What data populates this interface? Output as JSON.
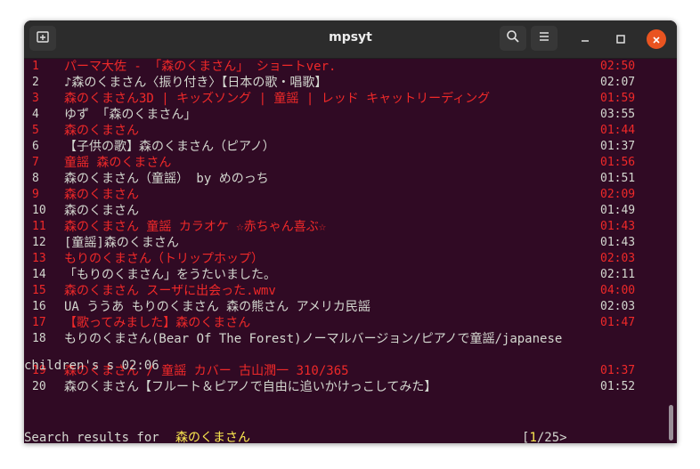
{
  "window": {
    "title": "mpsyt"
  },
  "icons": {
    "new_tab": "new-tab-icon",
    "search": "search-icon",
    "menu": "hamburger-menu-icon",
    "minimize": "minimize-icon",
    "maximize": "maximize-icon",
    "close": "close-icon"
  },
  "colors": {
    "terminal_bg": "#300a24",
    "odd_row": "#ef2929",
    "even_row": "#d3d7cf",
    "highlight": "#fce94f",
    "close_button": "#e95420"
  },
  "results": [
    {
      "num": "1",
      "title": "パーマ大佐 - 「森のくまさん」 ショートver.",
      "duration": "02:50"
    },
    {
      "num": "2",
      "title": "♪森のくまさん〈振り付き〉【日本の歌・唱歌】",
      "duration": "02:07"
    },
    {
      "num": "3",
      "title": "森のくまさん3D | キッズソング | 童謡  | レッド キャットリーディング",
      "duration": "01:59"
    },
    {
      "num": "4",
      "title": "ゆず  「森のくまさん」",
      "duration": "03:55"
    },
    {
      "num": "5",
      "title": "森のくまさん",
      "duration": "01:44"
    },
    {
      "num": "6",
      "title": "【子供の歌】森のくまさん（ピアノ）",
      "duration": "01:37"
    },
    {
      "num": "7",
      "title": "童謡 森のくまさん",
      "duration": "01:56"
    },
    {
      "num": "8",
      "title": "森のくまさん（童謡）  by めのっち",
      "duration": "01:51"
    },
    {
      "num": "9",
      "title": "森のくまさん",
      "duration": "02:09"
    },
    {
      "num": "10",
      "title": "森のくまさん",
      "duration": "01:49"
    },
    {
      "num": "11",
      "title": "森のくまさん  童謡  カラオケ  ☆赤ちゃん喜ぶ☆",
      "duration": "01:43"
    },
    {
      "num": "12",
      "title": "[童謡]森のくまさん",
      "duration": "01:43"
    },
    {
      "num": "13",
      "title": "もりのくまさん（トリップホップ）",
      "duration": "02:03"
    },
    {
      "num": "14",
      "title": "「もりのくまさん」をうたいました。",
      "duration": "02:11"
    },
    {
      "num": "15",
      "title": "森のくまさん スーザに出会った.wmv",
      "duration": "04:00"
    },
    {
      "num": "16",
      "title": "UA ううあ もりのくまさん 森の熊さん アメリカ民謡",
      "duration": "02:03"
    },
    {
      "num": "17",
      "title": "【歌ってみました】森のくまさん",
      "duration": "01:47"
    },
    {
      "num": "18",
      "title": "もりのくまさん(Bear Of The Forest)ノーマルバージョン/ピアノで童謡/japanese",
      "duration": ""
    },
    {
      "num": "19",
      "title": "森のくまさん / 童謡 カバー 古山潤一 310/365",
      "duration": "01:37"
    },
    {
      "num": "20",
      "title": "森のくまさん【フルート＆ピアノで自由に追いかけっこしてみた】",
      "duration": "01:52"
    }
  ],
  "row18_wrap": "children's s  02:06",
  "status": {
    "prefix": "Search results for ",
    "query": "森のくまさん",
    "page_open": "[",
    "page_current": "1",
    "page_rest": "/25>"
  },
  "prompt": {
    "symbol": ">"
  }
}
